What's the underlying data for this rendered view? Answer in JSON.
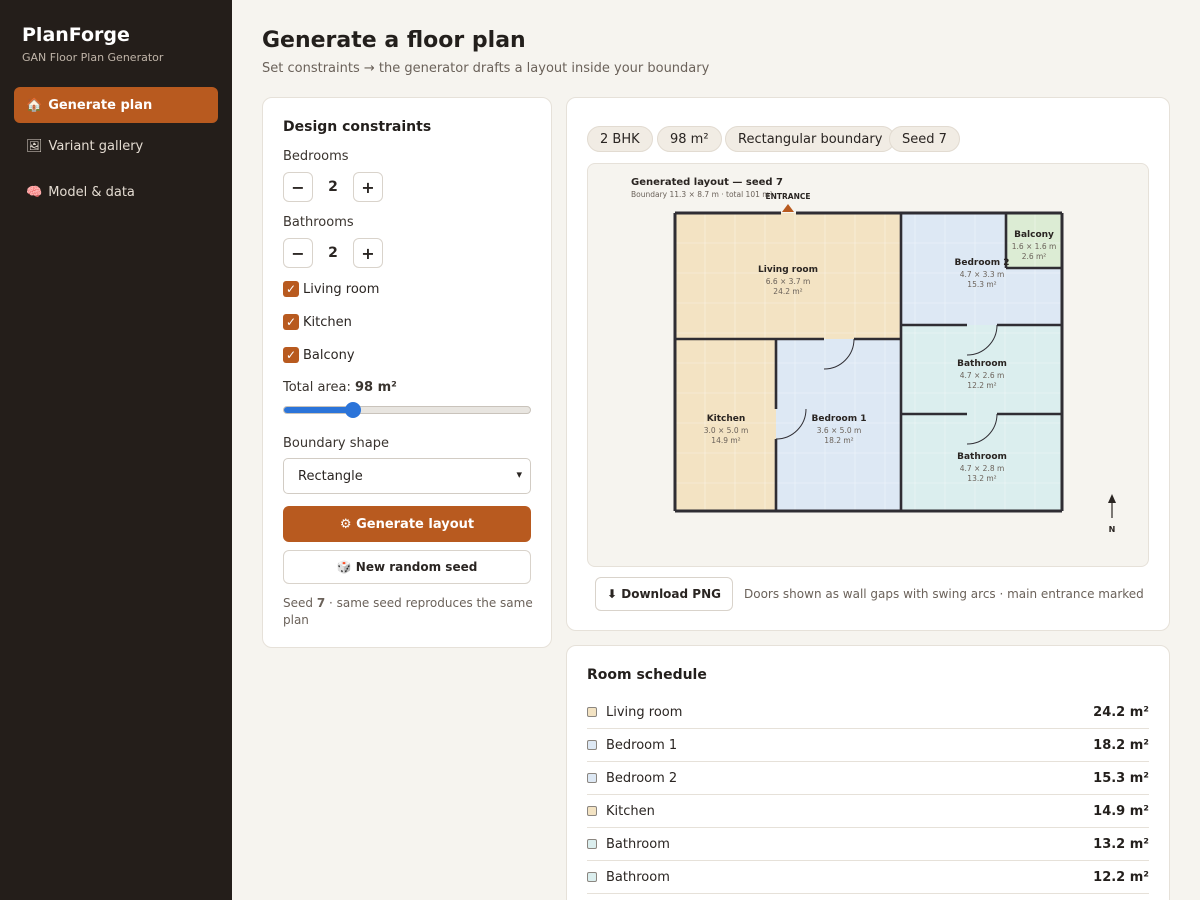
{
  "app": {
    "name": "PlanForge",
    "subtitle": "GAN Floor Plan Generator"
  },
  "nav": [
    {
      "icon": "🏠",
      "label": "Generate plan",
      "active": true
    },
    {
      "icon": "🖼",
      "label": "Variant gallery",
      "active": false
    },
    {
      "icon": "🧠",
      "label": "Model & data",
      "active": false
    }
  ],
  "page": {
    "title": "Generate a floor plan",
    "subtitle": "Set constraints → the generator drafts a layout inside your boundary"
  },
  "constraints": {
    "title": "Design constraints",
    "bedrooms_label": "Bedrooms",
    "bedrooms_value": "2",
    "bathrooms_label": "Bathrooms",
    "bathrooms_value": "2",
    "minus": "−",
    "plus": "+",
    "checks": [
      {
        "label": "Living room",
        "checked": true
      },
      {
        "label": "Kitchen",
        "checked": true
      },
      {
        "label": "Balcony",
        "checked": true
      }
    ],
    "area_label": "Total area:",
    "area_value": "98 m²",
    "area_fraction": 0.28,
    "shape_label": "Boundary shape",
    "shape_value": "Rectangle",
    "generate_label": "⚙ Generate layout",
    "seed_label": "🎲 New random seed",
    "seed_note_prefix": "Seed ",
    "seed_number": "7",
    "seed_note_suffix": " · same seed reproduces the same plan"
  },
  "plan": {
    "chips": [
      "2 BHK",
      "98 m²",
      "Rectangular boundary",
      "Seed 7"
    ],
    "title": "Generated layout — seed 7",
    "subtitle": "Boundary 11.3 × 8.7 m · total 101 m²",
    "entrance": "ENTRANCE",
    "north": "N",
    "rooms": [
      {
        "name": "Living room",
        "dims": "6.6 × 3.7 m",
        "area": "24.2 m²"
      },
      {
        "name": "Bedroom 2",
        "dims": "4.7 × 3.3 m",
        "area": "15.3 m²"
      },
      {
        "name": "Balcony",
        "dims": "1.6 × 1.6 m",
        "area": "2.6 m²"
      },
      {
        "name": "Bathroom",
        "dims": "4.7 × 2.6 m",
        "area": "12.2 m²"
      },
      {
        "name": "Kitchen",
        "dims": "3.0 × 5.0 m",
        "area": "14.9 m²"
      },
      {
        "name": "Bedroom 1",
        "dims": "3.6 × 5.0 m",
        "area": "18.2 m²"
      },
      {
        "name": "Bathroom",
        "dims": "4.7 × 2.8 m",
        "area": "13.2 m²"
      }
    ],
    "download_label": "⬇ Download PNG",
    "note": "Doors shown as wall gaps with swing arcs · main entrance marked"
  },
  "schedule": {
    "title": "Room schedule",
    "rows": [
      {
        "name": "Living room",
        "area": "24.2 m²",
        "color": "#f3e3c3"
      },
      {
        "name": "Bedroom 1",
        "area": "18.2 m²",
        "color": "#dde8f4"
      },
      {
        "name": "Bedroom 2",
        "area": "15.3 m²",
        "color": "#dde8f4"
      },
      {
        "name": "Kitchen",
        "area": "14.9 m²",
        "color": "#f3e3c3"
      },
      {
        "name": "Bathroom",
        "area": "13.2 m²",
        "color": "#dbeeee"
      },
      {
        "name": "Bathroom",
        "area": "12.2 m²",
        "color": "#dbeeee"
      }
    ]
  },
  "colors": {
    "accent": "#b85a1f",
    "sidebar": "#241e1a",
    "slider": "#2b74d9"
  }
}
